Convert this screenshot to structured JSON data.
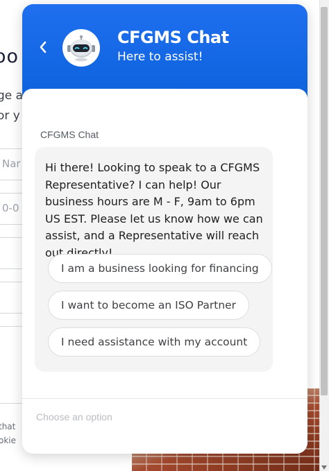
{
  "background_page": {
    "heading_fragment": "oo",
    "line_1_fragment": "ge a",
    "line_2_fragment": "or y",
    "field_1_placeholder_fragment": "Nar",
    "field_2_placeholder_fragment": "0-0",
    "footer_line_1_fragment": "that",
    "footer_line_2_fragment": "okie"
  },
  "chat": {
    "header": {
      "back_icon": "chevron-left-icon",
      "avatar_icon": "robot-icon",
      "title": "CFGMS Chat",
      "subtitle": "Here to assist!"
    },
    "message": {
      "sender": "CFGMS Chat",
      "text": "Hi there! Looking to speak to a CFGMS Representative? I can help! Our business hours are M - F, 9am to 6pm US EST. Please let us know how we can assist, and a Representative will reach out directly!",
      "options": [
        "I am a business looking for financing",
        "I want to become an ISO Partner",
        "I need assistance with my account"
      ]
    },
    "composer": {
      "placeholder": "Choose an option"
    }
  },
  "colors": {
    "header_blue": "#1566e6",
    "bubble_bg": "#f4f4f5",
    "option_border": "#dcdde0"
  }
}
